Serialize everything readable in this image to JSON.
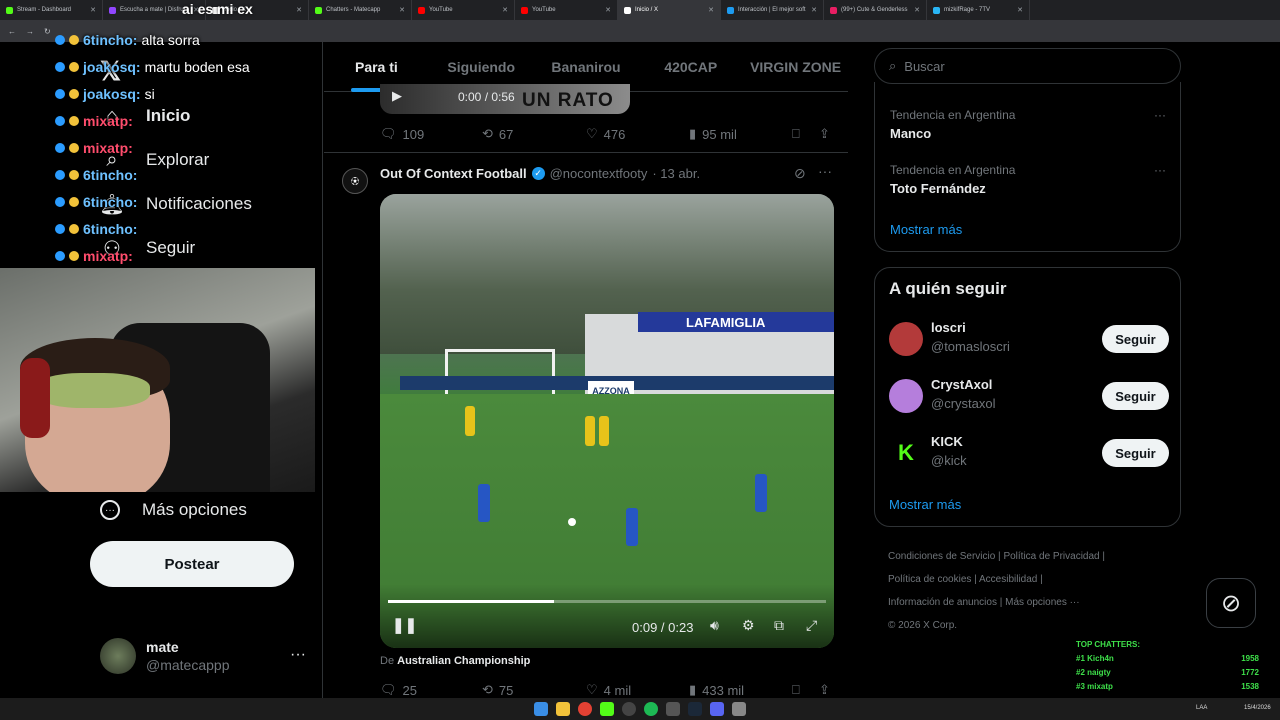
{
  "browser": {
    "tabs": [
      {
        "label": "Stream - Dashboard",
        "color": "#53fc18"
      },
      {
        "label": "Escucha a mate | Disfruta",
        "color": "#9146ff"
      },
      {
        "label": "Inicio / X",
        "color": "#ffffff"
      },
      {
        "label": "Chatters - Matecapp",
        "color": "#53fc18"
      },
      {
        "label": "YouTube",
        "color": "#ff0000"
      },
      {
        "label": "YouTube",
        "color": "#ff0000"
      },
      {
        "label": "Inicio / X",
        "color": "#ffffff"
      },
      {
        "label": "Interacción | El mejor soft",
        "color": "#1d9bf0"
      },
      {
        "label": "(99+) Cute & Genderless",
        "color": "#e91e63"
      },
      {
        "label": "mizkifRage - 7TV",
        "color": "#29b6f6"
      }
    ]
  },
  "chat": {
    "lines": [
      {
        "user": "6tincho:",
        "msg": "alta sorra",
        "color": "#6ec1ff"
      },
      {
        "user": "joakosq:",
        "msg": "martu boden esa",
        "color": "#6ec1ff"
      },
      {
        "user": "joakosq:",
        "msg": "si",
        "color": "#6ec1ff"
      },
      {
        "user": "mixatp:",
        "msg": "",
        "color": "#ff4d6d"
      },
      {
        "user": "mixatp:",
        "msg": "",
        "color": "#ff4d6d"
      },
      {
        "user": "6tincho:",
        "msg": "",
        "color": "#6ec1ff"
      },
      {
        "user": "6tincho:",
        "msg": "",
        "color": "#6ec1ff"
      },
      {
        "user": "6tincho:",
        "msg": "",
        "color": "#6ec1ff"
      },
      {
        "user": "mixatp:",
        "msg": "",
        "color": "#ff4d6d"
      }
    ],
    "overlay_text": "ai es mi ex"
  },
  "nav": {
    "items": [
      "Inicio",
      "Explorar",
      "Notificaciones",
      "Seguir"
    ],
    "more": "Más opciones",
    "post": "Postear",
    "user_name": "mate",
    "user_handle": "@matecappp"
  },
  "feed": {
    "tabs": [
      "Para ti",
      "Siguiendo",
      "Bananirou",
      "420CAP",
      "VIRGIN ZONE"
    ],
    "prev_post": {
      "video_time": "0:00 / 0:56",
      "video_caption": "UN RATO",
      "replies": "109",
      "reposts": "67",
      "likes": "476",
      "views": "95 mil"
    },
    "post": {
      "author": "Out Of Context Football",
      "handle": "@nocontextfooty",
      "date": "· 13 abr.",
      "video_time": "0:09 / 0:23",
      "progress": 0.38,
      "banner": "LAFAMIGLIA",
      "ad": "AZZONA",
      "source_prefix": "De",
      "source": "Australian Championship",
      "replies": "25",
      "reposts": "75",
      "likes": "4 mil",
      "views": "433 mil"
    }
  },
  "sidebar": {
    "search_placeholder": "Buscar",
    "trends": [
      {
        "context": "Tendencia en Argentina",
        "name": "Manco"
      },
      {
        "context": "Tendencia en Argentina",
        "name": "Toto Fernández"
      }
    ],
    "show_more": "Mostrar más",
    "who_to_follow_title": "A quién seguir",
    "follow": [
      {
        "name": "loscri",
        "handle": "@tomasloscri",
        "avatar_color": "#b33a3a"
      },
      {
        "name": "CrystAxol",
        "handle": "@crystaxol",
        "avatar_color": "#b57edc"
      },
      {
        "name": "KICK",
        "handle": "@kick",
        "avatar_color": "#000000"
      }
    ],
    "follow_label": "Seguir",
    "show_more_2": "Mostrar más",
    "footer": [
      "Condiciones de Servicio",
      "Política de Privacidad",
      "Política de cookies",
      "Accesibilidad",
      "Información de anuncios",
      "Más opciones ···"
    ],
    "copyright": "© 2026 X Corp."
  },
  "top_chatters": {
    "title": "TOP CHATTERS:",
    "rows": [
      {
        "name": "#1 Kich4n",
        "count": "1958"
      },
      {
        "name": "#2 naigty",
        "count": "1772"
      },
      {
        "name": "#3 mixatp",
        "count": "1538"
      }
    ]
  },
  "taskbar": {
    "lang": "LAA",
    "time": "15/4/2026"
  }
}
